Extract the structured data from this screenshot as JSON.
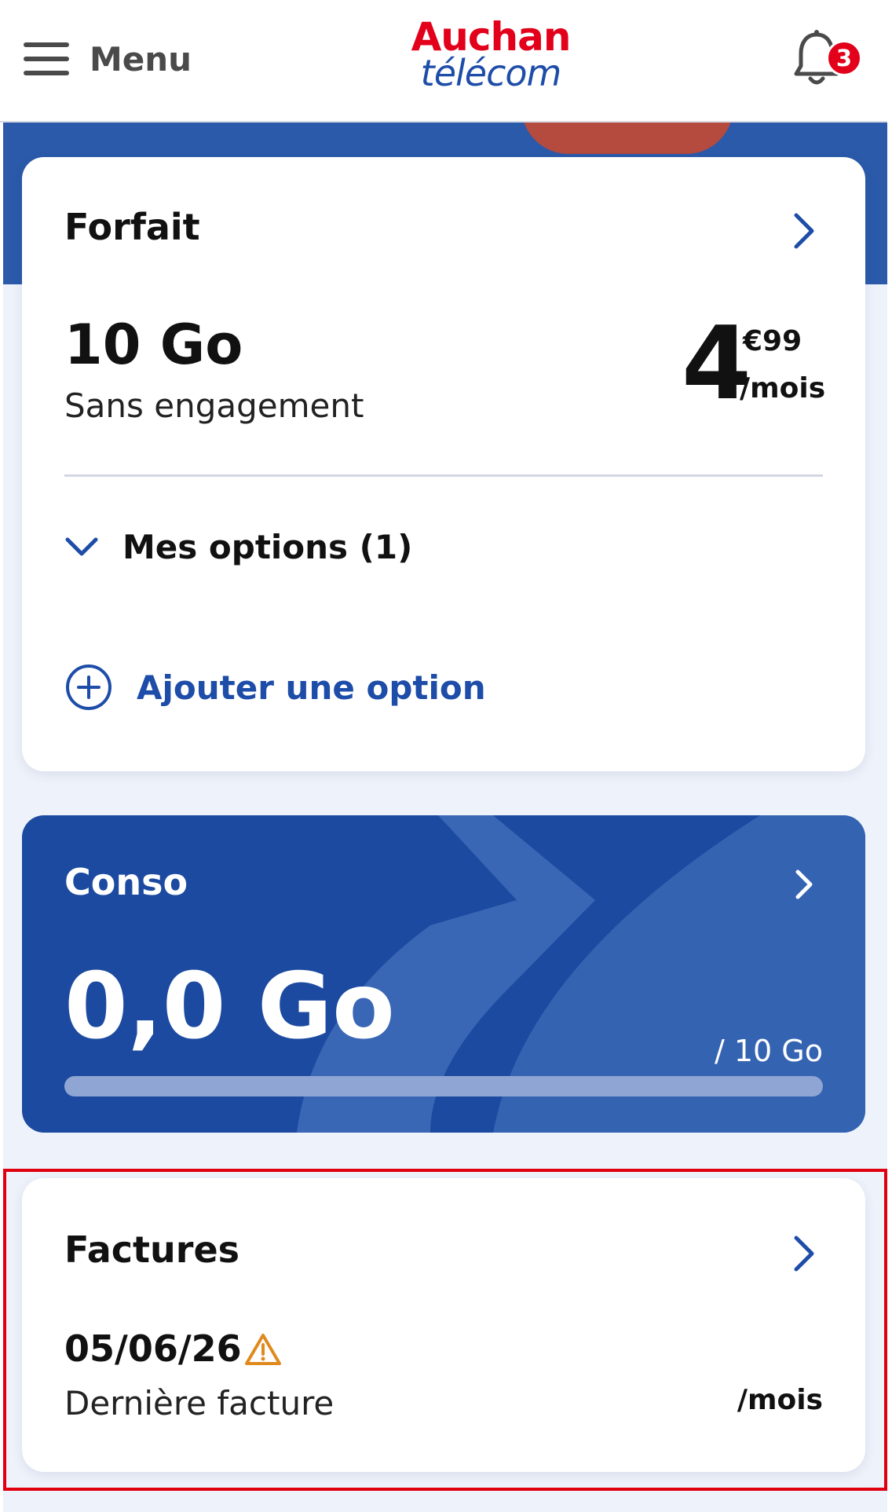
{
  "header": {
    "menu_label": "Menu",
    "logo_top": "Auchan",
    "logo_bottom": "télécom",
    "notifications_count": "3",
    "brand_red": "#e2001a",
    "brand_blue": "#1d4da8"
  },
  "forfait": {
    "title": "Forfait",
    "plan_name": "10 Go",
    "plan_subtitle": "Sans engagement",
    "price_main": "4",
    "price_cents": "€99",
    "price_unit": "/mois",
    "options_label": "Mes options (1)",
    "add_option_label": "Ajouter une option"
  },
  "conso": {
    "title": "Conso",
    "used": "0,0 Go",
    "total": "/ 10 Go",
    "usage_fraction": 0.0
  },
  "factures": {
    "title": "Factures",
    "date": "05/06/26",
    "subtitle": "Dernière facture",
    "unit": "/mois"
  },
  "icons": [
    "hamburger-icon",
    "bell-icon",
    "chevron-right-icon",
    "chevron-down-icon",
    "plus-circle-icon",
    "warning-icon"
  ]
}
